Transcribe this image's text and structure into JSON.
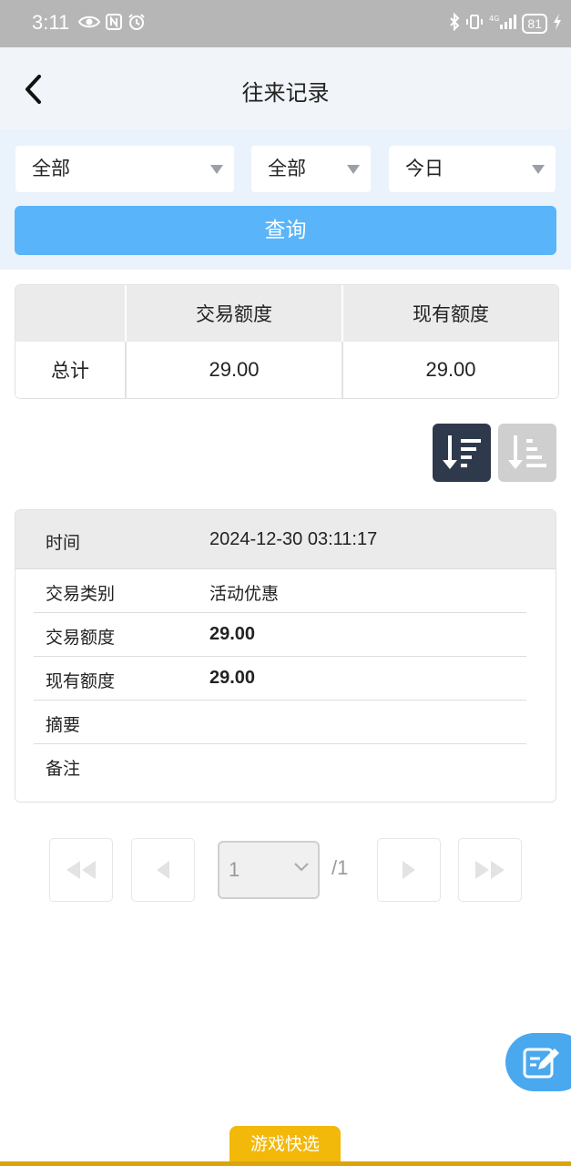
{
  "status_bar": {
    "time": "3:11",
    "battery": "81"
  },
  "header": {
    "title": "往来记录"
  },
  "filters": {
    "type_select": "全部",
    "status_select": "全部",
    "period_select": "今日",
    "query_label": "查询"
  },
  "summary": {
    "columns": [
      "交易额度",
      "现有额度"
    ],
    "row_label": "总计",
    "trade_amount": "29.00",
    "current_amount": "29.00"
  },
  "record": {
    "time_label": "时间",
    "time_value": "2024-12-30 03:11:17",
    "rows": [
      {
        "label": "交易类别",
        "value": "活动优惠"
      },
      {
        "label": "交易额度",
        "value": "29.00"
      },
      {
        "label": "现有额度",
        "value": "29.00"
      },
      {
        "label": "摘要",
        "value": ""
      },
      {
        "label": "备注",
        "value": ""
      }
    ]
  },
  "pagination": {
    "current_page": "1",
    "total_pages": "/1"
  },
  "quick_select": {
    "label": "游戏快选"
  },
  "colors": {
    "accent_blue": "#5ab4fa",
    "sort_active": "#2e3a4c",
    "quick_gold": "#f2b80a"
  }
}
